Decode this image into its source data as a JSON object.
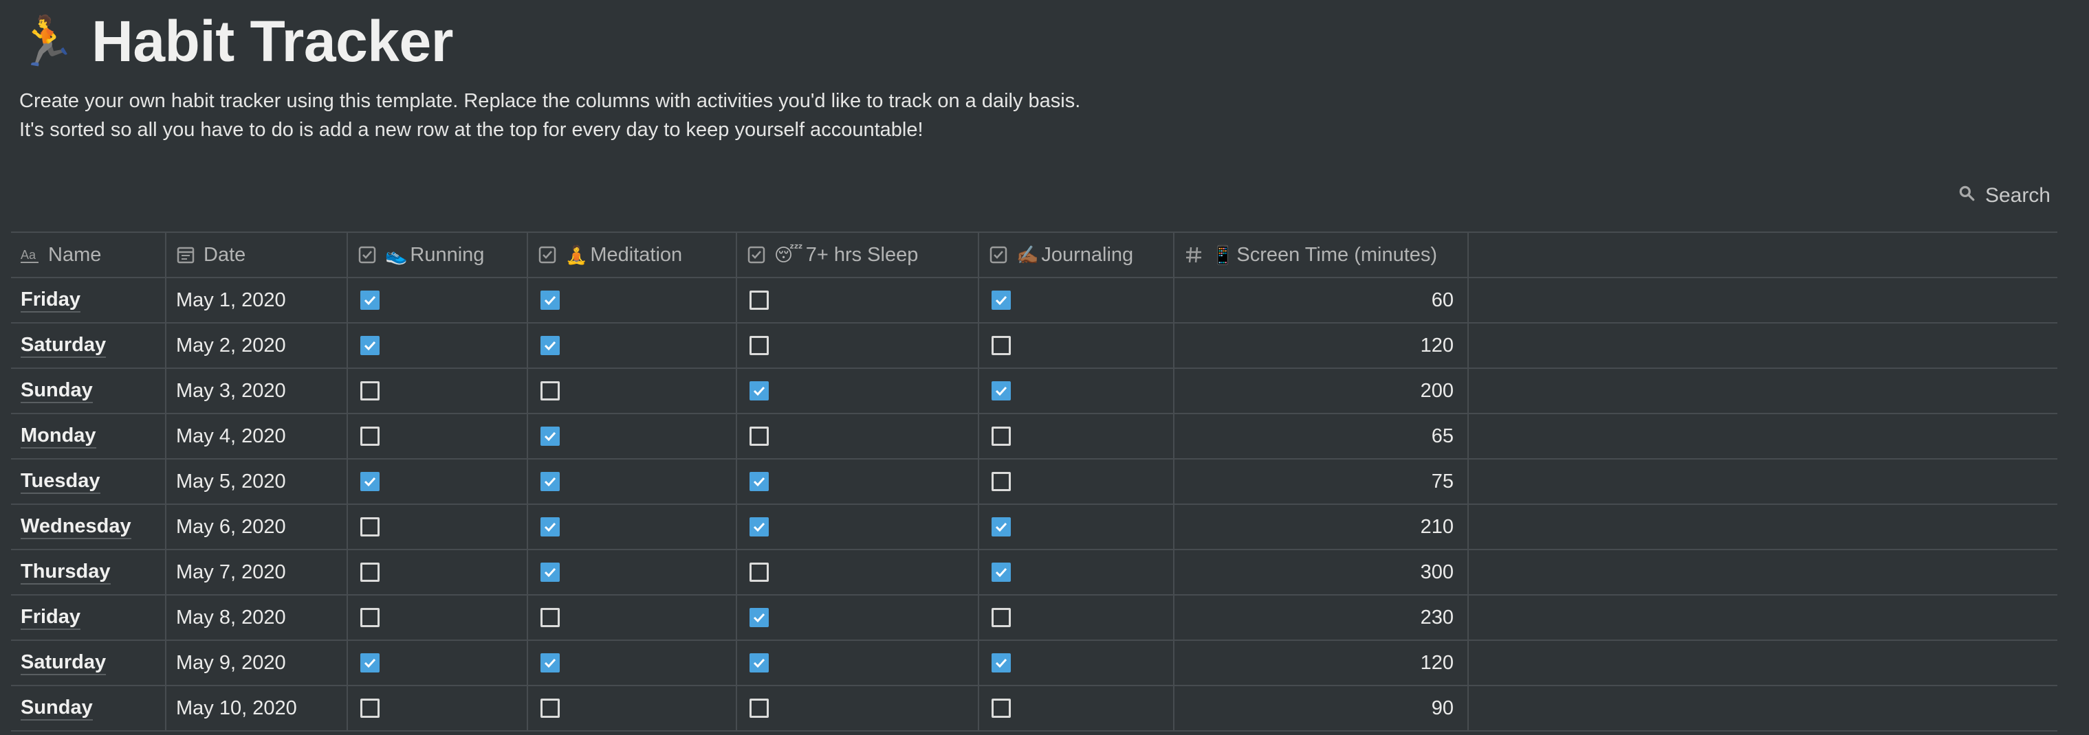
{
  "page": {
    "emoji": "🏃",
    "title": "Habit Tracker",
    "description": "Create your own habit tracker using this template. Replace the columns with activities you'd like to track on a daily basis. It's sorted so all you have to do is add a new row at the top for every day to keep yourself accountable!"
  },
  "search": {
    "label": "Search",
    "icon": "search-icon"
  },
  "columns": {
    "name": {
      "label": "Name",
      "icon": "text-property-icon"
    },
    "date": {
      "label": "Date",
      "icon": "calendar-icon"
    },
    "running": {
      "label": "Running",
      "emoji": "👟",
      "icon": "checkbox-property-icon"
    },
    "meditation": {
      "label": "Meditation",
      "emoji": "🧘",
      "icon": "checkbox-property-icon"
    },
    "sleep": {
      "label": "7+ hrs Sleep",
      "emoji": "😴",
      "icon": "checkbox-property-icon"
    },
    "journaling": {
      "label": "Journaling",
      "emoji": "✍🏾",
      "icon": "checkbox-property-icon"
    },
    "screen": {
      "label": "Screen Time (minutes)",
      "emoji": "📱",
      "icon": "number-property-icon"
    }
  },
  "rows": [
    {
      "name": "Friday",
      "date": "May 1, 2020",
      "running": true,
      "meditation": true,
      "sleep": false,
      "journaling": true,
      "screen": "60"
    },
    {
      "name": "Saturday",
      "date": "May 2, 2020",
      "running": true,
      "meditation": true,
      "sleep": false,
      "journaling": false,
      "screen": "120"
    },
    {
      "name": "Sunday",
      "date": "May 3, 2020",
      "running": false,
      "meditation": false,
      "sleep": true,
      "journaling": true,
      "screen": "200"
    },
    {
      "name": "Monday",
      "date": "May 4, 2020",
      "running": false,
      "meditation": true,
      "sleep": false,
      "journaling": false,
      "screen": "65"
    },
    {
      "name": "Tuesday",
      "date": "May 5, 2020",
      "running": true,
      "meditation": true,
      "sleep": true,
      "journaling": false,
      "screen": "75"
    },
    {
      "name": "Wednesday",
      "date": "May 6, 2020",
      "running": false,
      "meditation": true,
      "sleep": true,
      "journaling": true,
      "screen": "210"
    },
    {
      "name": "Thursday",
      "date": "May 7, 2020",
      "running": false,
      "meditation": true,
      "sleep": false,
      "journaling": true,
      "screen": "300"
    },
    {
      "name": "Friday",
      "date": "May 8, 2020",
      "running": false,
      "meditation": false,
      "sleep": true,
      "journaling": false,
      "screen": "230"
    },
    {
      "name": "Saturday",
      "date": "May 9, 2020",
      "running": true,
      "meditation": true,
      "sleep": true,
      "journaling": true,
      "screen": "120"
    },
    {
      "name": "Sunday",
      "date": "May 10, 2020",
      "running": false,
      "meditation": false,
      "sleep": false,
      "journaling": false,
      "screen": "90"
    }
  ],
  "colors": {
    "background": "#2f3437",
    "checkbox_checked": "#4aa3df",
    "grid": "#474c50"
  }
}
